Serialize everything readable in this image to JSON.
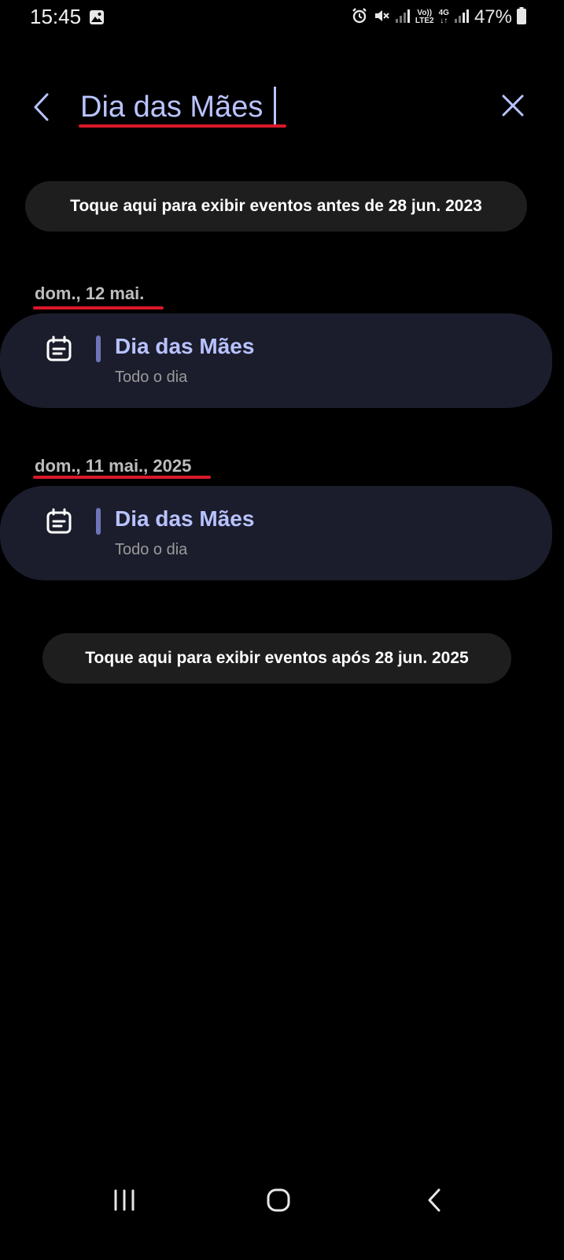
{
  "status_bar": {
    "time": "15:45",
    "network_label_1": "Vo))",
    "network_label_2": "LTE2",
    "network_4g": "4G",
    "battery": "47%"
  },
  "search": {
    "query": "Dia das Mães",
    "accent_color": "#b9c3ff"
  },
  "load_before": "Toque aqui para exibir eventos antes de 28 jun. 2023",
  "groups": [
    {
      "date": "dom., 12 mai.",
      "event": {
        "title": "Dia das Mães",
        "subtitle": "Todo o dia",
        "icon": "calendar-event-icon"
      }
    },
    {
      "date": "dom., 11 mai., 2025",
      "event": {
        "title": "Dia das Mães",
        "subtitle": "Todo o dia",
        "icon": "calendar-event-icon"
      }
    }
  ],
  "load_after": "Toque aqui para exibir eventos após 28 jun. 2025",
  "colors": {
    "background": "#000000",
    "card": "#1b1d2c",
    "pill": "#1e1e1e",
    "highlight": "#d9182a",
    "event_bar": "#6d75b8"
  }
}
